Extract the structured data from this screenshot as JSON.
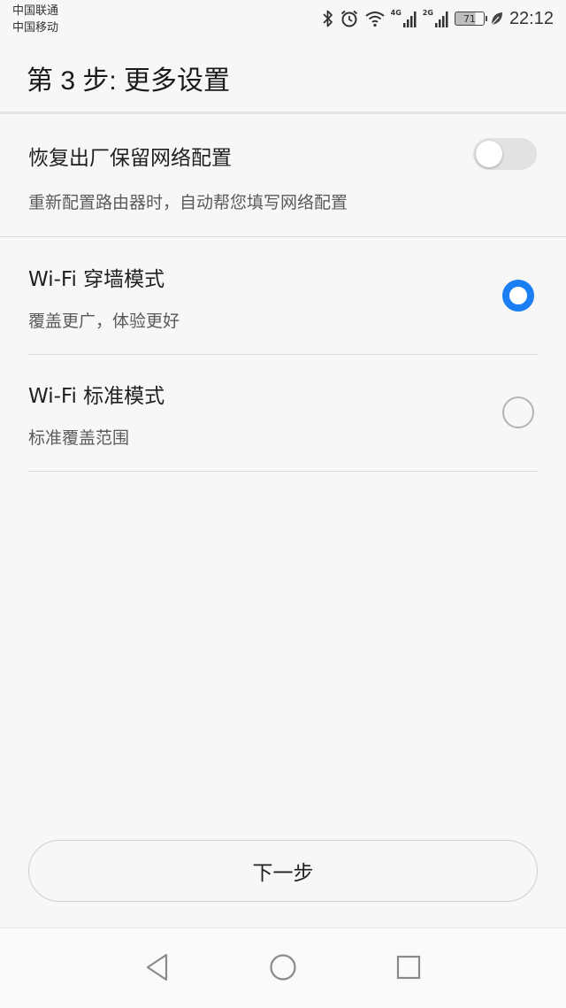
{
  "status_bar": {
    "carrier_1": "中国联通",
    "carrier_2": "中国移动",
    "network_1": "4G",
    "network_2": "2G",
    "battery": "71",
    "time": "22:12",
    "icons": [
      "bluetooth-icon",
      "alarm-icon",
      "wifi-icon",
      "signal-icon",
      "signal-icon",
      "battery-icon",
      "leaf-icon"
    ]
  },
  "header": {
    "title": "第 3 步: 更多设置"
  },
  "reset_setting": {
    "title": "恢复出厂保留网络配置",
    "description": "重新配置路由器时，自动帮您填写网络配置",
    "enabled": false
  },
  "modes": [
    {
      "title": "Wi-Fi 穿墙模式",
      "description": "覆盖更广，体验更好",
      "selected": true
    },
    {
      "title": "Wi-Fi 标准模式",
      "description": "标准覆盖范围",
      "selected": false
    }
  ],
  "next_button": {
    "label": "下一步"
  },
  "nav_bar": {
    "icons": [
      "back-icon",
      "home-icon",
      "recents-icon"
    ]
  },
  "colors": {
    "accent": "#1b7ff3",
    "background": "#f7f7f7",
    "divider": "#dcdcdc"
  }
}
